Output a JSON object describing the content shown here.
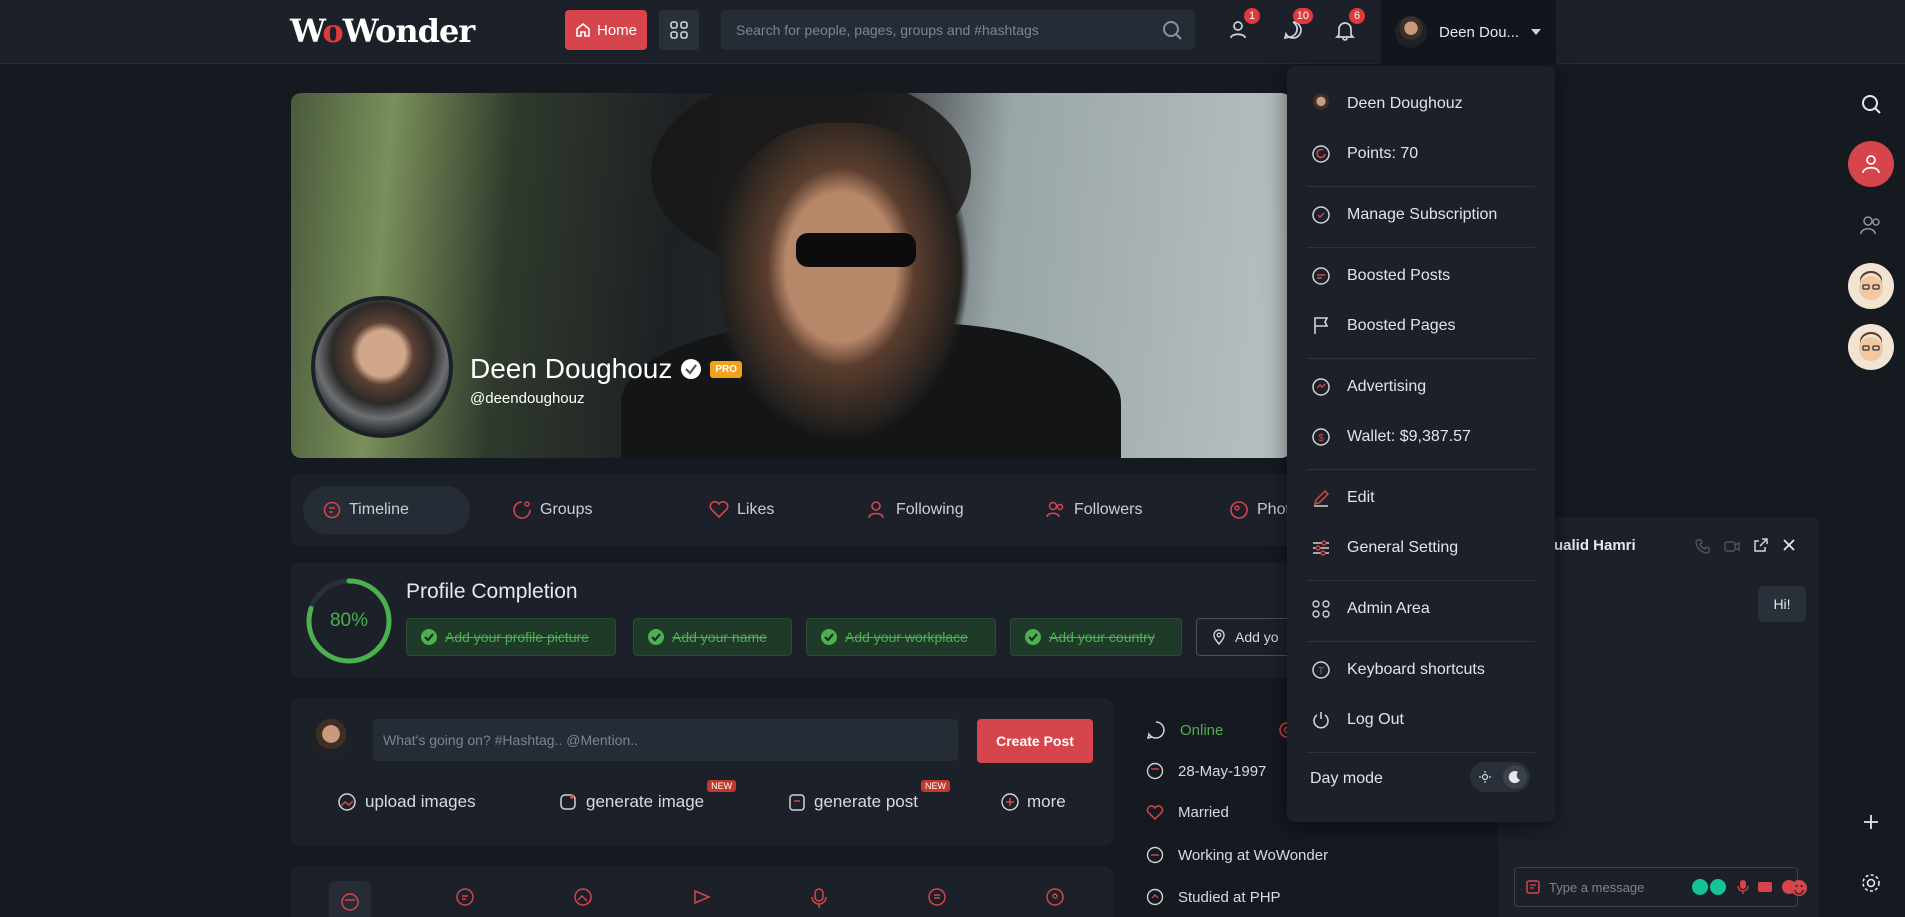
{
  "topbar": {
    "logo": "WoWonder",
    "home_label": "Home",
    "search_placeholder": "Search for people, pages, groups and #hashtags",
    "badges": {
      "friends": "1",
      "messages": "10",
      "notifications": "6"
    },
    "user_name": "Deen Dou..."
  },
  "profile": {
    "name": "Deen Doughouz",
    "pro_label": "PRO",
    "handle": "@deendoughouz"
  },
  "tabs": [
    {
      "label": "Timeline",
      "icon": "timeline-icon"
    },
    {
      "label": "Groups",
      "icon": "groups-icon"
    },
    {
      "label": "Likes",
      "icon": "heart-icon"
    },
    {
      "label": "Following",
      "icon": "user-plus-icon"
    },
    {
      "label": "Followers",
      "icon": "users-icon"
    },
    {
      "label": "Phot",
      "icon": "photo-icon"
    }
  ],
  "completion": {
    "percent_label": "80%",
    "percent": 80,
    "title": "Profile Completion",
    "chips": [
      "Add your profile picture",
      "Add your name",
      "Add your workplace",
      "Add your country",
      "Add yo"
    ]
  },
  "composer": {
    "placeholder": "What's going on? #Hashtag.. @Mention..",
    "create_label": "Create Post",
    "actions": [
      {
        "label": "upload images"
      },
      {
        "label": "generate image",
        "tag": "NEW"
      },
      {
        "label": "generate post",
        "tag": "NEW"
      },
      {
        "label": "more"
      }
    ]
  },
  "info": {
    "online": "Online",
    "birthday": "28-May-1997",
    "relationship": "Married",
    "work": "Working at WoWonder",
    "study": "Studied at PHP"
  },
  "dropdown": {
    "user": "Deen Doughouz",
    "points": "Points: 70",
    "manage_subscription": "Manage Subscription",
    "boosted_posts": "Boosted Posts",
    "boosted_pages": "Boosted Pages",
    "advertising": "Advertising",
    "wallet": "Wallet: $9,387.57",
    "edit": "Edit",
    "general_setting": "General Setting",
    "admin_area": "Admin Area",
    "keyboard_shortcuts": "Keyboard shortcuts",
    "log_out": "Log Out",
    "day_mode": "Day mode"
  },
  "chat": {
    "name": "ualid Hamri",
    "message": "Hi!",
    "input_placeholder": "Type a message"
  },
  "colors": {
    "accent": "#d6454b",
    "background": "#151a21",
    "panel": "#1c2129",
    "success": "#4caf50"
  }
}
